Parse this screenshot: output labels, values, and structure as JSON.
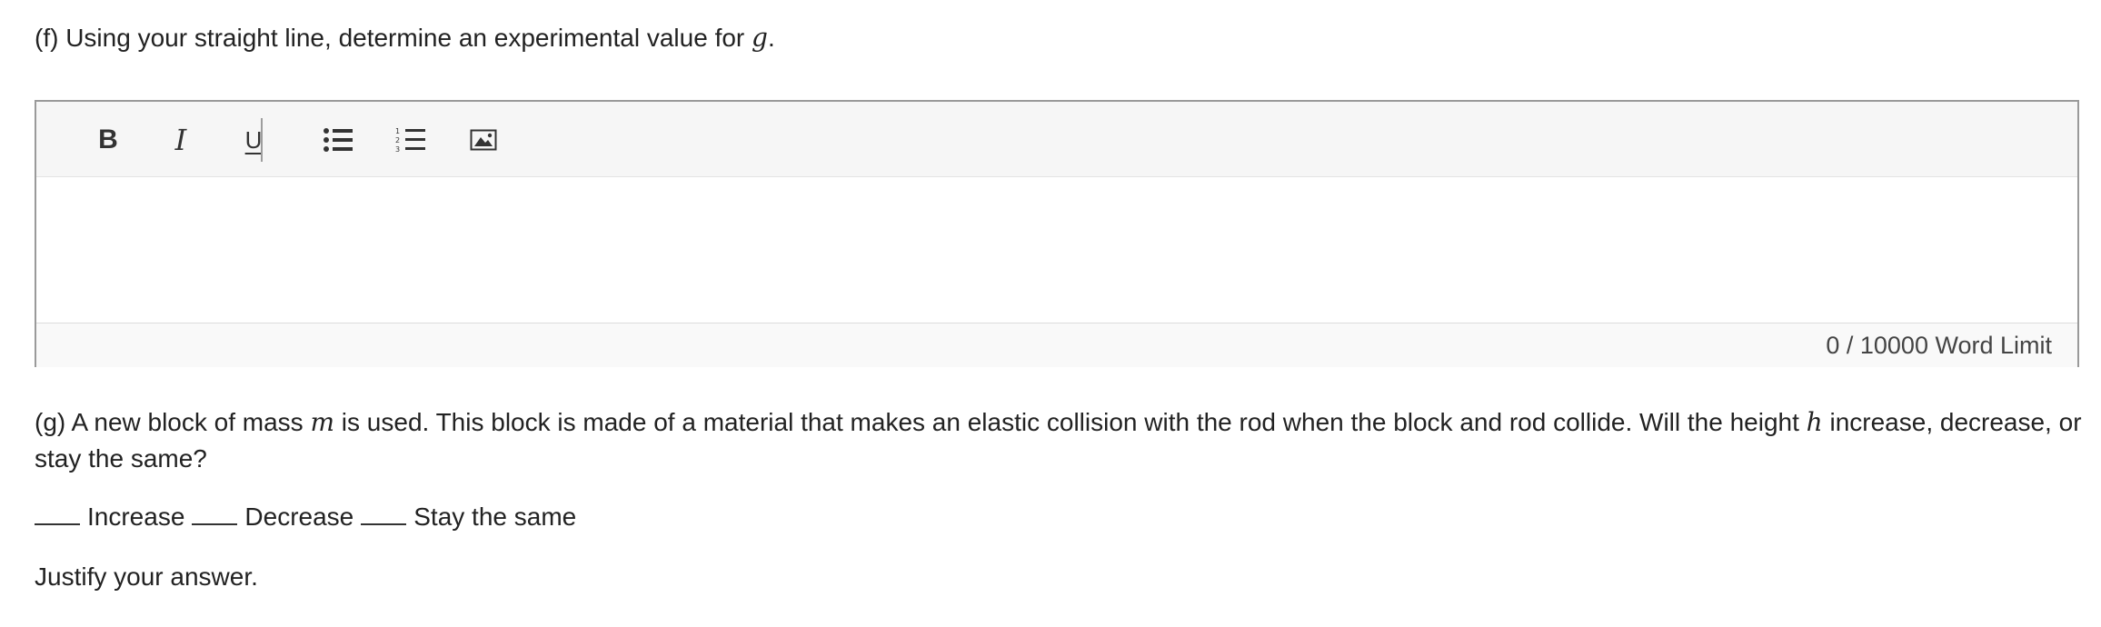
{
  "question_f": {
    "prefix": "(f) Using your straight line, determine an experimental value for ",
    "var": "g",
    "suffix": "."
  },
  "editor": {
    "toolbar": {
      "bold": "B",
      "italic": "I",
      "underline": "U"
    },
    "word_count": "0",
    "word_limit_text": "/ 10000 Word Limit"
  },
  "question_g": {
    "part1": "(g) A new block of mass ",
    "var_m": "m",
    "part2": " is used. This block is made of a material that makes an elastic collision with the rod when the block and rod collide. Will the height ",
    "var_h": "h",
    "part3": " increase, decrease, or stay the same?"
  },
  "options": [
    "Increase",
    "Decrease",
    "Stay the same"
  ],
  "justify": "Justify your answer."
}
